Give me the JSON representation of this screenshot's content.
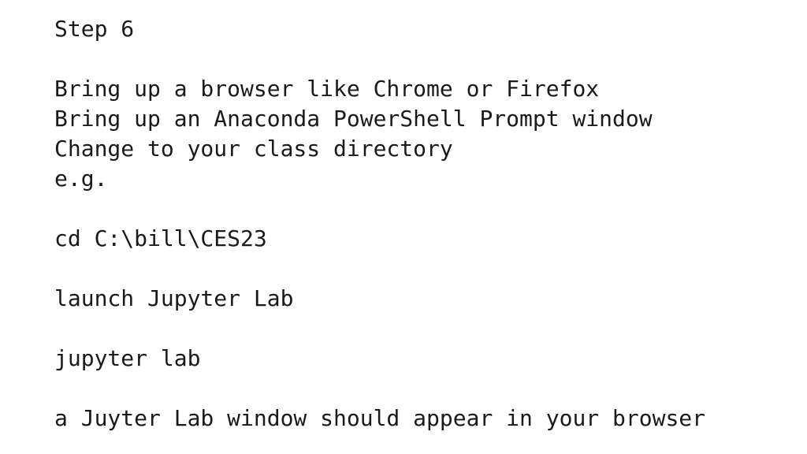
{
  "slide": {
    "background_color": "#ffffff",
    "text_color": "#1a1a1a",
    "title": "Step 6",
    "lines": [
      {
        "id": "heading",
        "text": "Step 6",
        "blank": false
      },
      {
        "id": "blank-1",
        "text": "",
        "blank": true
      },
      {
        "id": "instruction-browser",
        "text": "Bring up a browser like Chrome or Firefox",
        "blank": false
      },
      {
        "id": "instruction-powershell",
        "text": "Bring up an Anaconda PowerShell Prompt window",
        "blank": false
      },
      {
        "id": "instruction-change-dir",
        "text": "Change to your class directory",
        "blank": false
      },
      {
        "id": "instruction-eg",
        "text": "e.g.",
        "blank": false
      },
      {
        "id": "blank-2",
        "text": "",
        "blank": true
      },
      {
        "id": "command-cd",
        "text": "cd C:\\bill\\CES23",
        "blank": false
      },
      {
        "id": "blank-3",
        "text": "",
        "blank": true
      },
      {
        "id": "instruction-launch",
        "text": "launch Jupyter Lab",
        "blank": false
      },
      {
        "id": "blank-4",
        "text": "",
        "blank": true
      },
      {
        "id": "command-jupyter-lab",
        "text": "jupyter lab",
        "blank": false
      },
      {
        "id": "blank-5",
        "text": "",
        "blank": true
      },
      {
        "id": "result-window",
        "text": "a Juyter Lab window should appear in your browser",
        "blank": false
      }
    ]
  }
}
